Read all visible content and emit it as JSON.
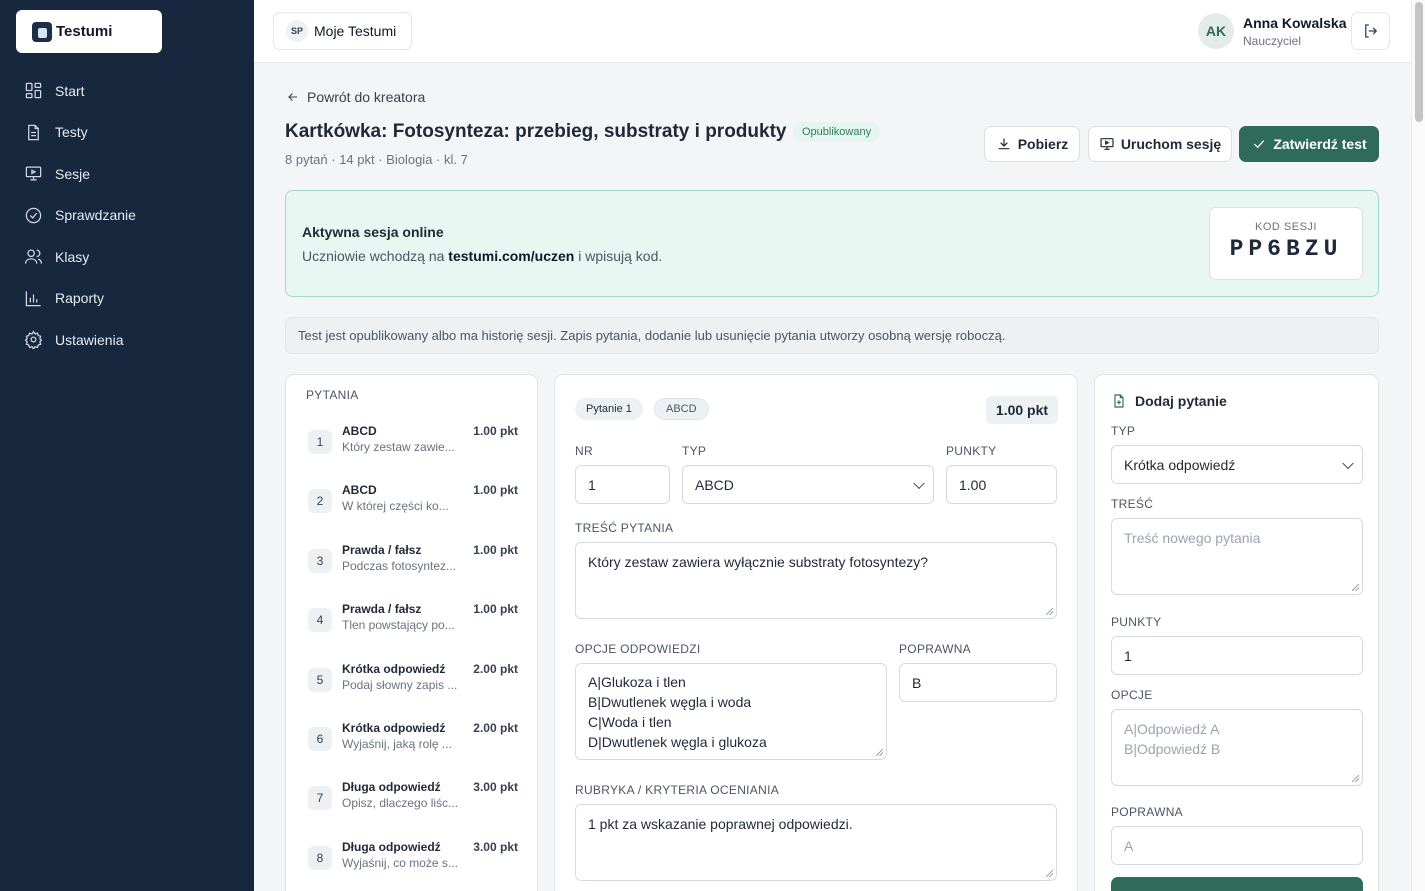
{
  "sidebar": {
    "logo_text": "Testumi",
    "items": [
      {
        "label": "Start",
        "icon": "dashboard-icon"
      },
      {
        "label": "Testy",
        "icon": "document-icon"
      },
      {
        "label": "Sesje",
        "icon": "monitor-icon"
      },
      {
        "label": "Sprawdzanie",
        "icon": "check-circle-icon"
      },
      {
        "label": "Klasy",
        "icon": "users-icon"
      },
      {
        "label": "Raporty",
        "icon": "bar-chart-icon"
      },
      {
        "label": "Ustawienia",
        "icon": "gear-icon"
      }
    ]
  },
  "topbar": {
    "workspace_badge": "SP",
    "workspace_name": "Moje Testumi",
    "avatar_initials": "AK",
    "user_name": "Anna Kowalska",
    "user_role": "Nauczyciel"
  },
  "header": {
    "back_label": "Powrót do kreatora",
    "title": "Kartkówka: Fotosynteza: przebieg, substraty i produkty",
    "status": "Opublikowany",
    "meta": "8 pytań · 14 pkt · Biologia · kl. 7",
    "download_label": "Pobierz",
    "session_label": "Uruchom sesję",
    "approve_label": "Zatwierdź test"
  },
  "session": {
    "title": "Aktywna sesja online",
    "desc_before": "Uczniowie wchodzą na ",
    "desc_link": "testumi.com/uczen",
    "desc_after": " i wpisują kod.",
    "code_label": "KOD SESJI",
    "code": "PP6BZU"
  },
  "notice": "Test jest opublikowany albo ma historię sesji. Zapis pytania, dodanie lub usunięcie pytania utworzy osobną wersję roboczą.",
  "questions": {
    "heading": "PYTANIA",
    "items": [
      {
        "num": "1",
        "type": "ABCD",
        "points": "1.00 pkt",
        "text": "Który zestaw zawie..."
      },
      {
        "num": "2",
        "type": "ABCD",
        "points": "1.00 pkt",
        "text": "W której części ko..."
      },
      {
        "num": "3",
        "type": "Prawda / fałsz",
        "points": "1.00 pkt",
        "text": "Podczas fotosyntez..."
      },
      {
        "num": "4",
        "type": "Prawda / fałsz",
        "points": "1.00 pkt",
        "text": "Tlen powstający po..."
      },
      {
        "num": "5",
        "type": "Krótka odpowiedź",
        "points": "2.00 pkt",
        "text": "Podaj słowny zapis ..."
      },
      {
        "num": "6",
        "type": "Krótka odpowiedź",
        "points": "2.00 pkt",
        "text": "Wyjaśnij, jaką rolę ..."
      },
      {
        "num": "7",
        "type": "Długa odpowiedź",
        "points": "3.00 pkt",
        "text": "Opisz, dlaczego liśc..."
      },
      {
        "num": "8",
        "type": "Długa odpowiedź",
        "points": "3.00 pkt",
        "text": "Wyjaśnij, co może s..."
      }
    ]
  },
  "editor": {
    "tag_question": "Pytanie 1",
    "tag_type": "ABCD",
    "points_badge": "1.00 pkt",
    "nr_label": "NR",
    "nr_value": "1",
    "type_label": "TYP",
    "type_value": "ABCD",
    "points_label": "PUNKTY",
    "points_value": "1.00",
    "content_label": "TREŚĆ PYTANIA",
    "content_value": "Który zestaw zawiera wyłącznie substraty fotosyntezy?",
    "options_label": "OPCJE ODPOWIEDZI",
    "options": [
      "A|Glukoza i tlen",
      "B|Dwutlenek węgla i woda",
      "C|Woda i tlen",
      "D|Dwutlenek węgla i glukoza"
    ],
    "correct_label": "POPRAWNA",
    "correct_value": "B",
    "rubric_label": "RUBRYKA / KRYTERIA OCENIANIA",
    "rubric_value": "1 pkt za wskazanie poprawnej odpowiedzi."
  },
  "add": {
    "title": "Dodaj pytanie",
    "type_label": "TYP",
    "type_value": "Krótka odpowiedź",
    "content_label": "TREŚĆ",
    "content_placeholder": "Treść nowego pytania",
    "points_label": "PUNKTY",
    "points_value": "1",
    "options_label": "OPCJE",
    "options_placeholder": [
      "A|Odpowiedź A",
      "B|Odpowiedź B"
    ],
    "correct_label": "POPRAWNA",
    "correct_placeholder": "A"
  },
  "colors": {
    "sidebar_bg": "#17273d",
    "accent": "#2e6b5a",
    "session_bg": "#e8f7f1"
  }
}
